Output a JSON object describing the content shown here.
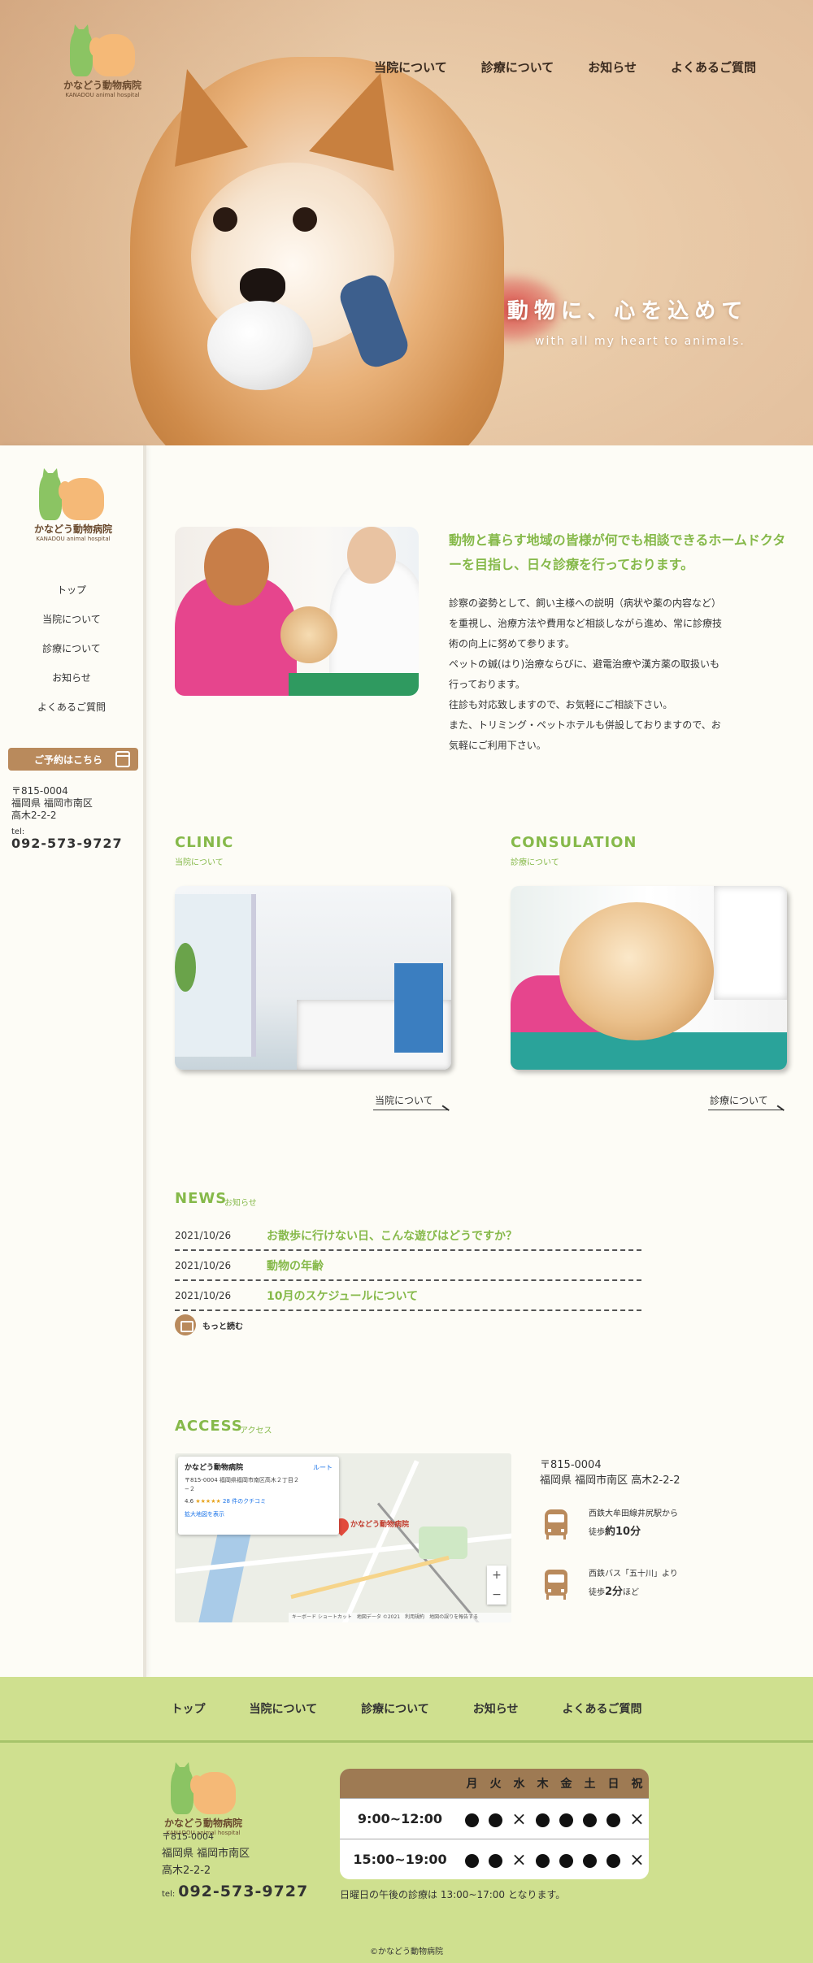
{
  "logo": {
    "name": "かなどう動物病院",
    "sub": "KANADOU animal hospital"
  },
  "nav": [
    "当院について",
    "診療について",
    "お知らせ",
    "よくあるご質問"
  ],
  "hero": {
    "catch": "動物に、心を込めて",
    "catch_en": "with all my heart to animals."
  },
  "sidebar": {
    "items": [
      "トップ",
      "当院について",
      "診療について",
      "お知らせ",
      "よくあるご質問"
    ],
    "reserve": "ご予約はこちら",
    "zip": "〒815-0004",
    "address1": "福岡県 福岡市南区",
    "address2": "高木2-2-2",
    "tel_label": "tel:",
    "tel": "092-573-9727"
  },
  "intro": {
    "heading": "動物と暮らす地域の皆様が何でも相談できるホームドクターを目指し、日々診療を行っております。",
    "lines": [
      "診察の姿勢として、飼い主様への説明（病状や薬の内容など）",
      "を重視し、治療方法や費用など相談しながら進め、常に診療技",
      "術の向上に努めて参ります。",
      "ペットの鍼(はり)治療ならびに、避電治療や漢方薬の取扱いも",
      "行っております。",
      "往診も対応致しますので、お気軽にご相談下さい。",
      "また、トリミング・ペットホテルも併設しておりますので、お",
      "気軽にご利用下さい。"
    ]
  },
  "clinic": {
    "title": "CLINIC",
    "sub": "当院について",
    "link": "当院について"
  },
  "consul": {
    "title": "CONSULATION",
    "sub": "診療について",
    "link": "診療について"
  },
  "news": {
    "title": "NEWS",
    "sub": "お知らせ",
    "items": [
      {
        "date": "2021/10/26",
        "title": "お散歩に行けない日、こんな遊びはどうですか？"
      },
      {
        "date": "2021/10/26",
        "title": "動物の年齢"
      },
      {
        "date": "2021/10/26",
        "title": "10月のスケジュールについて"
      }
    ],
    "more": "もっと読む"
  },
  "access": {
    "title": "ACCESS",
    "sub": "アクセス",
    "map": {
      "name": "かなどう動物病院",
      "addr": "〒815-0004 福岡県福岡市南区高木２丁目２−２",
      "rating": "4.6",
      "stars": "★★★★★",
      "reviews": "28 件のクチコミ",
      "enlarge": "拡大地図を表示",
      "route": "ルート",
      "pin_label": "かなどう動物病院",
      "footer": "キーボード ショートカット　地図データ ©2021　利用規約　地図の誤りを報告する"
    },
    "zip": "〒815-0004",
    "address": "福岡県 福岡市南区 高木2-2-2",
    "routes": [
      {
        "line1": "西鉄大牟田線井尻駅から",
        "prefix": "徒歩",
        "time": "約10分",
        "suffix": ""
      },
      {
        "line1": "西鉄バス「五十川」より",
        "prefix": "徒歩",
        "time": "2分",
        "suffix": "ほど"
      }
    ]
  },
  "footer": {
    "nav": [
      "トップ",
      "当院について",
      "診療について",
      "お知らせ",
      "よくあるご質問"
    ],
    "zip": "〒815-0004",
    "address1": "福岡県 福岡市南区",
    "address2": "高木2-2-2",
    "tel_label": "tel:",
    "tel": "092-573-9727",
    "hours": {
      "days": [
        "月",
        "火",
        "水",
        "木",
        "金",
        "土",
        "日",
        "祝"
      ],
      "rows": [
        {
          "time": "9:00~12:00",
          "cells": [
            "●",
            "●",
            "×",
            "●",
            "●",
            "●",
            "●",
            "×"
          ]
        },
        {
          "time": "15:00~19:00",
          "cells": [
            "●",
            "●",
            "×",
            "●",
            "●",
            "●",
            "●",
            "×"
          ]
        }
      ]
    },
    "note": "日曜日の午後の診療は 13:00~17:00 となります。",
    "copyright": "©かなどう動物病院"
  },
  "colors": {
    "accent": "#86b94a",
    "brown": "#b98a5c",
    "footer_bg": "#cfe08f"
  }
}
